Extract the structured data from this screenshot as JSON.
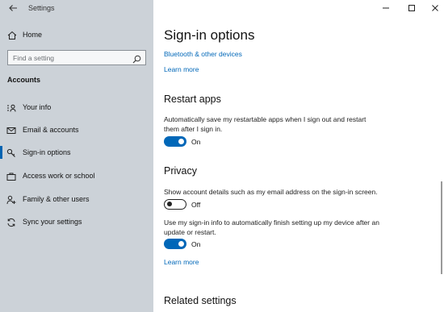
{
  "window": {
    "app_title": "Settings",
    "controls": {
      "minimize": "—",
      "maximize": "☐",
      "close": "✕"
    }
  },
  "sidebar": {
    "home_label": "Home",
    "search_placeholder": "Find a setting",
    "section_header": "Accounts",
    "items": [
      {
        "label": "Your info",
        "icon": "person-card-icon"
      },
      {
        "label": "Email & accounts",
        "icon": "mail-icon"
      },
      {
        "label": "Sign-in options",
        "icon": "key-icon",
        "active": true
      },
      {
        "label": "Access work or school",
        "icon": "briefcase-icon"
      },
      {
        "label": "Family & other users",
        "icon": "person-add-icon"
      },
      {
        "label": "Sync your settings",
        "icon": "sync-icon"
      }
    ]
  },
  "main": {
    "title": "Sign-in options",
    "links_top": {
      "bluetooth": "Bluetooth & other devices",
      "learn_more": "Learn more"
    },
    "restart_apps": {
      "heading": "Restart apps",
      "description": "Automatically save my restartable apps when I sign out and restart them after I sign in.",
      "toggle_state": "On"
    },
    "privacy": {
      "heading": "Privacy",
      "account_details": {
        "description": "Show account details such as my email address on the sign-in screen.",
        "toggle_state": "Off"
      },
      "sign_in_info": {
        "description": "Use my sign-in info to automatically finish setting up my device after an update or restart.",
        "toggle_state": "On"
      },
      "learn_more": "Learn more"
    },
    "related_settings": {
      "heading": "Related settings"
    }
  },
  "colors": {
    "accent": "#0067b8",
    "sidebar_bg": "#ccd2d8"
  }
}
